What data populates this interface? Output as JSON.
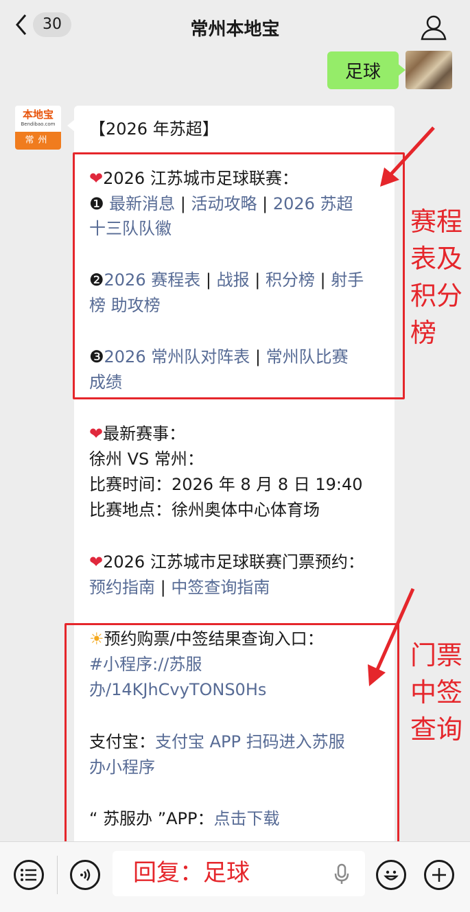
{
  "header": {
    "back_count": "30",
    "title": "常州本地宝"
  },
  "outgoing": {
    "text": "足球"
  },
  "bot_avatar": {
    "logo_text": "本地宝",
    "logo_sub": "Bendibao.com",
    "city": "常州"
  },
  "message": {
    "heading": "【2026 年苏超】",
    "s1_title": "2026 江苏城市足球联赛：",
    "s1_num": "❶",
    "link_news": "最新消息",
    "link_guide": "活动攻略",
    "link_badges_1": "2026 苏超",
    "link_badges_2": "十三队队徽",
    "s2_num": "❷",
    "link_schedule": "2026 赛程表",
    "link_report": "战报",
    "link_points": "积分榜",
    "link_scorers_1": "射手",
    "link_scorers_2": "榜",
    "link_assists": "助攻榜",
    "s3_num": "❸",
    "link_lineup": "2026 常州队对阵表",
    "link_results_1": "常州队比赛",
    "link_results_2": "成绩",
    "s4_title": "最新赛事：",
    "match": "徐州 VS 常州：",
    "time": "比赛时间：2026 年 8 月 8 日 19:40",
    "venue": "比赛地点：徐州奥体中心体育场",
    "s5_title": "2026 江苏城市足球联赛门票预约：",
    "link_reserve": "预约指南",
    "link_lottery": "中签查询指南",
    "s6_title": "预约购票/中签结果查询入口：",
    "mini_1": "#小程序://苏服",
    "mini_2": "办/14KJhCvyTONS0Hs",
    "alipay_label": "支付宝：",
    "alipay_1": "支付宝 APP 扫码进入苏服",
    "alipay_2": "办小程序",
    "app_label": "“ 苏服办 ”APP：",
    "app_link": "点击下载"
  },
  "annotations": {
    "schedule": [
      "赛程",
      "表及",
      "积分",
      "榜"
    ],
    "ticket": [
      "门票",
      "中签",
      "查询"
    ],
    "color": "#e5262b"
  },
  "input": {
    "text": "回复：足球"
  },
  "colors": {
    "link": "#576b95",
    "outgoing_bubble": "#95ec69",
    "background": "#ededed"
  }
}
